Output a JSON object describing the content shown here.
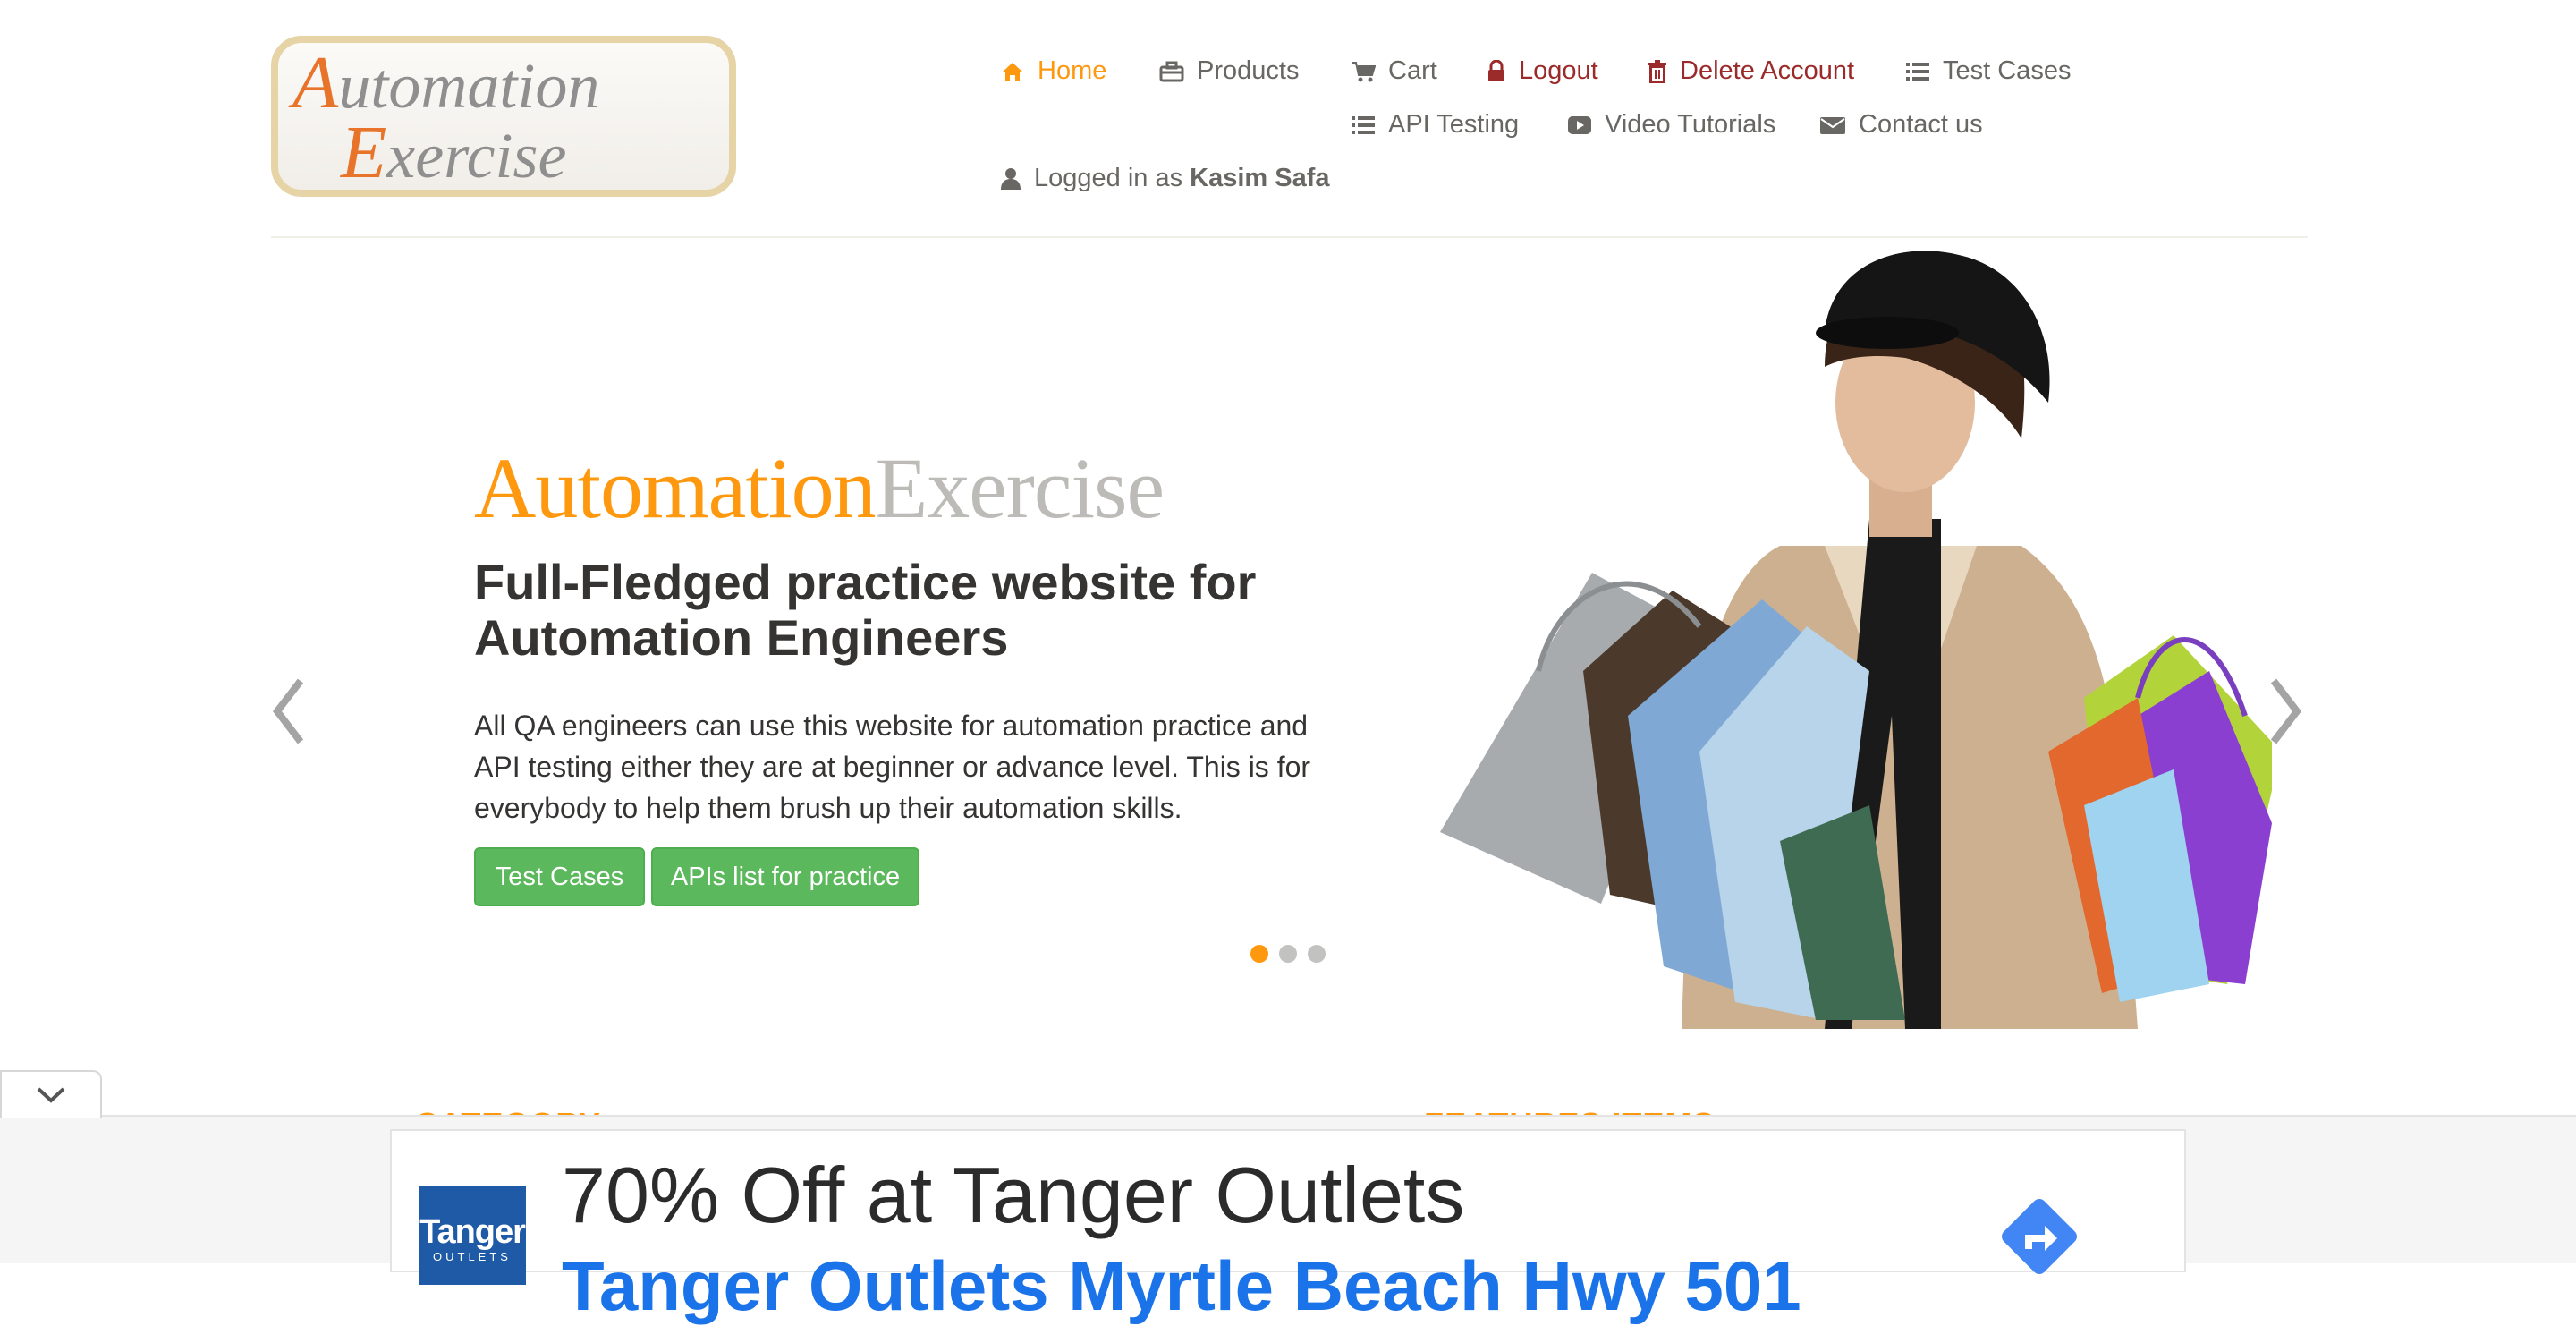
{
  "header": {
    "logo": {
      "line1": "Automation",
      "line2": "Exercise"
    },
    "nav": {
      "home": "Home",
      "products": "Products",
      "cart": "Cart",
      "logout": "Logout",
      "delete_account": "Delete Account",
      "test_cases": "Test Cases",
      "api_testing": "API Testing",
      "video_tutorials": "Video Tutorials",
      "contact_us": "Contact us",
      "logged_in_prefix": "Logged in as",
      "logged_in_user": "Kasim Safa"
    }
  },
  "slider": {
    "brand_part1": "Automation",
    "brand_part2": "Exercise",
    "heading": "Full-Fledged practice website for Automation Engineers",
    "text": "All QA engineers can use this website for automation practice and API testing either they are at beginner or advance level. This is for everybody to help them brush up their automation skills.",
    "buttons": {
      "test_cases": "Test Cases",
      "apis_list": "APIs list for practice"
    },
    "active_slide": 1,
    "slide_count": 3
  },
  "sections": {
    "category": "CATEGORY",
    "features": "FEATURES ITEMS"
  },
  "ad": {
    "brand": "Tanger",
    "brand_sub": "OUTLETS",
    "headline": "70% Off at Tanger Outlets",
    "subline": "Tanger Outlets Myrtle Beach Hwy 501"
  },
  "colors": {
    "accent": "#FE980F",
    "text": "#696763",
    "danger": "#9b2a2a",
    "button_green": "#5cb85c",
    "ad_link": "#1a73e8",
    "ad_brand": "#1f5aa6"
  }
}
